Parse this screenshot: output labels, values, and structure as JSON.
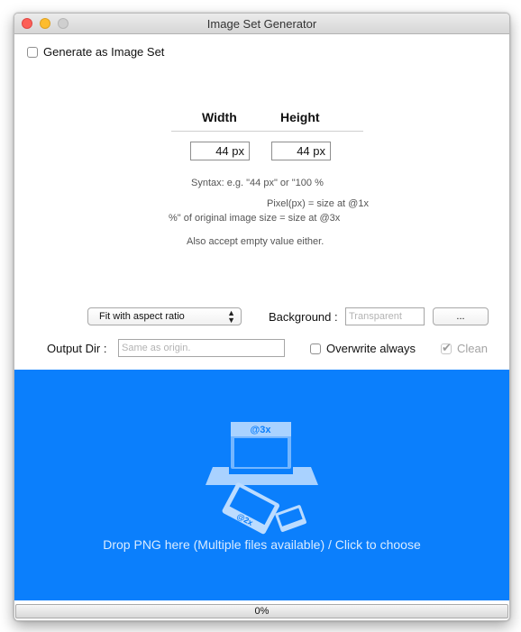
{
  "window": {
    "title": "Image Set Generator"
  },
  "options": {
    "generate_label": "Generate as Image Set"
  },
  "size": {
    "width_header": "Width",
    "height_header": "Height",
    "width_value": "44 px",
    "height_value": "44 px",
    "hint_syntax": "Syntax: e.g. \"44 px\" or \"100 %",
    "hint_pixel": "Pixel(px) = size at @1x",
    "hint_percent": "%\" of original image size = size at @3x",
    "hint_empty": "Also accept empty value either."
  },
  "controls": {
    "scale_mode": "Fit with aspect ratio",
    "background_label": "Background :",
    "background_placeholder": "Transparent",
    "browse_label": "...",
    "output_label": "Output Dir :",
    "output_placeholder": "Same as origin.",
    "overwrite_label": "Overwrite always",
    "clean_label": "Clean"
  },
  "drop": {
    "text": "Drop PNG here (Multiple files available) / Click to choose",
    "badge_3x": "@3x",
    "badge_2x": "@2x",
    "accent": "#0b7ffc"
  },
  "progress": {
    "label": "0%",
    "value": 0
  }
}
